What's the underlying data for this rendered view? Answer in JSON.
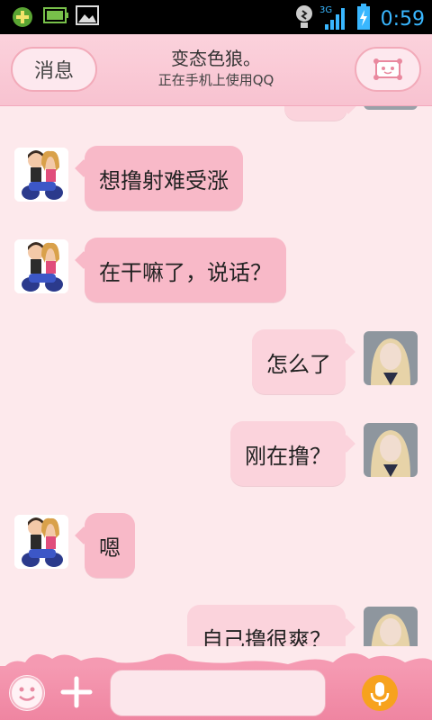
{
  "status_bar": {
    "time": "0:59",
    "network": "3G"
  },
  "header": {
    "back_label": "消息",
    "title": "变态色狼。",
    "subtitle": "正在手机上使用QQ"
  },
  "messages": [
    {
      "side": "left",
      "text": "想撸射难受涨"
    },
    {
      "side": "left",
      "text": "在干嘛了，说话？"
    },
    {
      "side": "right",
      "text": "怎么了"
    },
    {
      "side": "right",
      "text": "刚在撸？"
    },
    {
      "side": "left",
      "text": "嗯"
    },
    {
      "side": "right",
      "text": "自己撸很爽？"
    }
  ],
  "input": {
    "placeholder": ""
  },
  "colors": {
    "header_bg": "#f8c2d0",
    "bubble_left": "#f8b9c8",
    "bubble_right": "#fbd3dc",
    "bottom_bar": "#ef85a1",
    "mic": "#f7a21e",
    "time": "#39b7ff"
  }
}
